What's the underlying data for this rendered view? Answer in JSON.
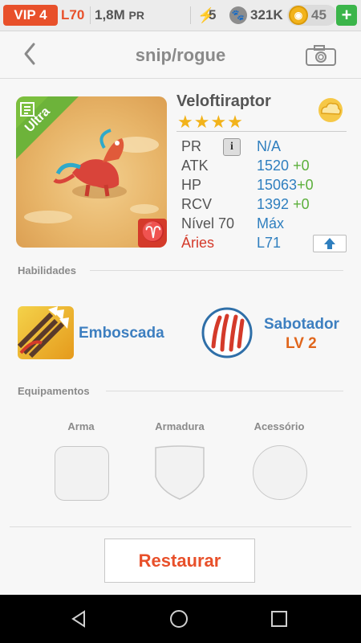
{
  "topbar": {
    "vip": "VIP 4",
    "level": "L70",
    "pr_count": "1,8M",
    "pr_suffix": "PR",
    "energy": "5",
    "paw_value": "321K",
    "coins": "45",
    "plus_label": "+"
  },
  "header": {
    "title": "snip/rogue",
    "back_icon": "chevron-left-icon",
    "camera_icon": "camera-icon"
  },
  "monster": {
    "rarity": "Ultra",
    "name": "Veloftiraptor",
    "stars": "★★★★",
    "star_count": 4,
    "element_icon": "cloud-element-icon",
    "stats": {
      "pr_label": "PR",
      "pr_value": "N/A",
      "atk_label": "ATK",
      "atk_value": "1520",
      "atk_bonus": "+0",
      "hp_label": "HP",
      "hp_value": "15063",
      "hp_bonus": "+0",
      "rcv_label": "RCV",
      "rcv_value": "1392",
      "rcv_bonus": "+0",
      "level_label": "Nível 70",
      "level_value": "Máx",
      "sign_label": "Áries",
      "sign_value": "L71"
    },
    "colors": {
      "blue": "#2f7fbf",
      "green": "#5cb03c",
      "red": "#d43a2a",
      "orange": "#e8502a"
    }
  },
  "skills": {
    "section_title": "Habilidades",
    "items": [
      {
        "name": "Emboscada",
        "icon": "arrows-skill-icon"
      },
      {
        "name": "Sabotador",
        "level": "LV 2",
        "icon": "claw-skill-icon"
      }
    ]
  },
  "equipment": {
    "section_title": "Equipamentos",
    "slots": [
      {
        "label": "Arma"
      },
      {
        "label": "Armadura"
      },
      {
        "label": "Acessório"
      }
    ]
  },
  "actions": {
    "restore": "Restaurar"
  }
}
